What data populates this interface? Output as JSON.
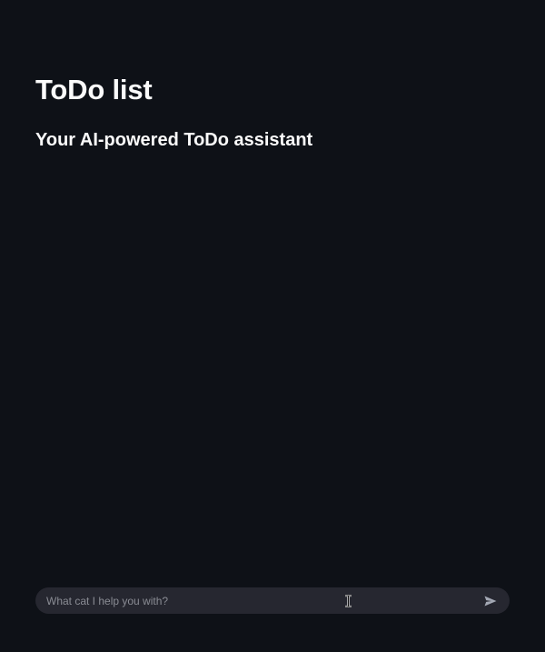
{
  "main": {
    "title": "ToDo list",
    "subtitle": "Your AI-powered ToDo assistant"
  },
  "chat": {
    "placeholder": "What cat I help you with?",
    "value": "",
    "send_icon": "send-icon"
  },
  "colors": {
    "background": "#0e1117",
    "input_background": "#262730",
    "text": "#fafafa",
    "placeholder": "#8a8c94",
    "send_icon": "#a3a8b4"
  }
}
